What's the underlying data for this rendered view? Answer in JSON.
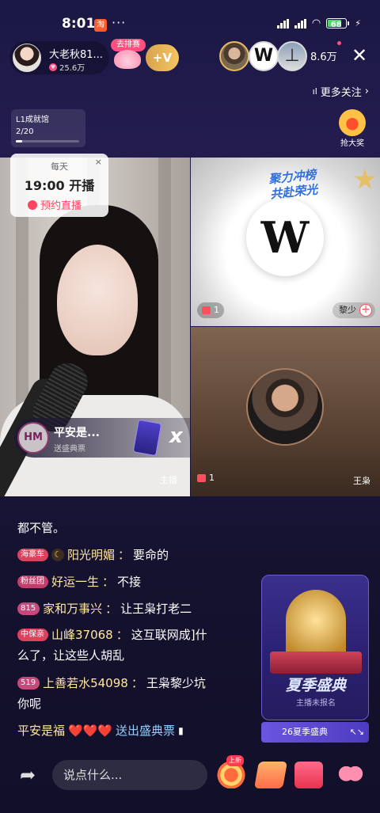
{
  "statusbar": {
    "time": "8:01",
    "app_badge": "淘",
    "more": "···",
    "network": "4G",
    "battery": "68"
  },
  "header": {
    "host_name": "大老秋81...",
    "host_likes": "25.6万",
    "rank_tag": "去排赛",
    "follow_label": "+V",
    "viewer_w": "W",
    "viewer_3": "⊥",
    "viewer_count": "8.6万",
    "close": "✕",
    "more_follow": "更多关注",
    "more_follow_chevron": "›"
  },
  "level": {
    "title": "L1成就馆",
    "progress_text": "2/20",
    "progress": 0.1
  },
  "grab_prize": {
    "label": "抢大奖"
  },
  "schedule": {
    "daily": "每天",
    "time": "19:00",
    "start": "开播",
    "reserve": "预约直播",
    "close": "×"
  },
  "gift_notice": {
    "avatar_text": "HM",
    "sender": "平安是...",
    "desc": "送盛典票",
    "multiplier": "x 1"
  },
  "video": {
    "main_label": "主播",
    "promo_line1": "聚力冲榜",
    "promo_line2": "共赴荣光",
    "guest_a_logo": "W",
    "guest_a_gifts": "1",
    "guest_a_name": "黎少",
    "guest_b_gifts": "1",
    "guest_b_name": "王枭"
  },
  "chat": [
    {
      "text": "都不管。"
    },
    {
      "badge": "海豪车",
      "user": "阳光明媚",
      "sep": "：",
      "msg": "要命的"
    },
    {
      "badge": "粉丝团",
      "user": "好运一生",
      "sep": "：",
      "msg": "不接"
    },
    {
      "badge": "815",
      "user": "家和万事兴",
      "sep": "：",
      "msg": "让王枭打老二"
    },
    {
      "badge": "中保亲",
      "user": "山峰37068",
      "sep": "：",
      "msg": "这互联网成]什"
    },
    {
      "text": "么了，让这些人胡乱"
    },
    {
      "badge": "519",
      "user": "上善若水54098",
      "sep": "：",
      "msg": "王枭黎少坑"
    },
    {
      "text": "你呢"
    },
    {
      "user": "平安是福",
      "hearts": "❤️❤️❤️",
      "msg": "送出盛典票"
    }
  ],
  "event": {
    "title": "夏季盛典",
    "sub": "主播未报名",
    "bar": "26夏季盛典",
    "expand": "↖↘"
  },
  "bottombar": {
    "share": "➦",
    "input_placeholder": "说点什么...",
    "new_tag": "上新"
  },
  "colors": {
    "accent": "#ff4f7e",
    "gold": "#e8b95e",
    "chat_user": "#ffe7a0"
  }
}
